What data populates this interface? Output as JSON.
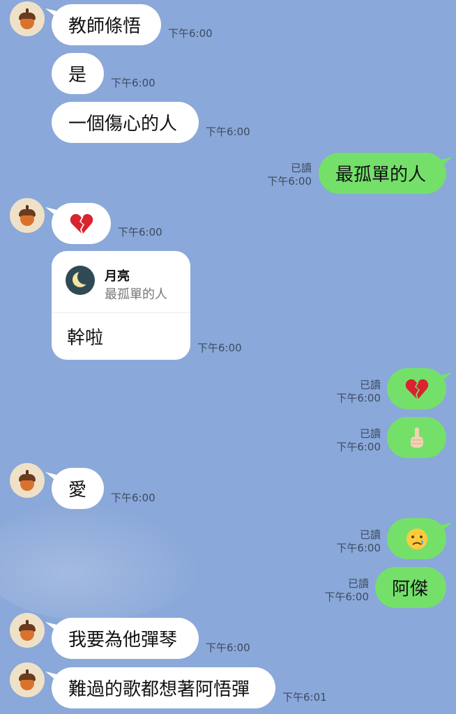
{
  "colors": {
    "background": "#8aa8d9",
    "incoming_bubble": "#ffffff",
    "outgoing_bubble": "#74e06a"
  },
  "messages": [
    {
      "id": "m1",
      "side": "in",
      "text": "教師條悟",
      "time": "下午6:00"
    },
    {
      "id": "m2",
      "side": "in",
      "text": "是",
      "time": "下午6:00"
    },
    {
      "id": "m3",
      "side": "in",
      "text": "一個傷心的人",
      "time": "下午6:00"
    },
    {
      "id": "m4",
      "side": "out",
      "text": "最孤單的人",
      "read": "已讀",
      "time": "下午6:00"
    },
    {
      "id": "m5",
      "side": "in",
      "emoji": "broken-heart",
      "time": "下午6:00"
    },
    {
      "id": "m6",
      "side": "in",
      "reply_to": {
        "name": "月亮",
        "quote": "最孤單的人"
      },
      "text": "幹啦",
      "time": "下午6:00"
    },
    {
      "id": "m7",
      "side": "out",
      "emoji": "broken-heart",
      "read": "已讀",
      "time": "下午6:00"
    },
    {
      "id": "m8",
      "side": "out",
      "emoji": "middle-finger",
      "read": "已讀",
      "time": "下午6:00"
    },
    {
      "id": "m9",
      "side": "in",
      "text": "愛",
      "time": "下午6:00"
    },
    {
      "id": "m10",
      "side": "out",
      "emoji": "crying-face",
      "read": "已讀",
      "time": "下午6:00"
    },
    {
      "id": "m11",
      "side": "out",
      "text": "阿傑",
      "read": "已讀",
      "time": "下午6:00"
    },
    {
      "id": "m12",
      "side": "in",
      "text": "我要為他彈琴",
      "time": "下午6:00"
    },
    {
      "id": "m13",
      "side": "in",
      "text": "難過的歌都想著阿悟彈",
      "time": "下午6:01"
    }
  ],
  "icons": {
    "avatar": "acorn-icon",
    "reply_avatar": "moon-icon"
  }
}
